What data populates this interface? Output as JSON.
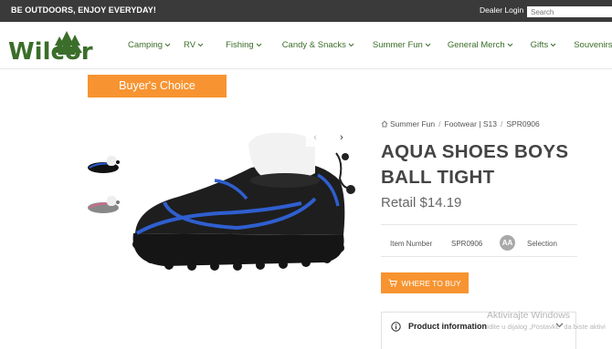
{
  "topbar": {
    "tagline": "BE OUTDOORS, ENJOY EVERYDAY!",
    "dealer_login": "Dealer Login",
    "search_placeholder": "Search"
  },
  "brand": {
    "logo_text": "Wilcor",
    "color": "#3b6e2a"
  },
  "nav": [
    {
      "label": "Camping"
    },
    {
      "label": "RV"
    },
    {
      "label": "Fishing"
    },
    {
      "label": "Candy & Snacks"
    },
    {
      "label": "Summer Fun"
    },
    {
      "label": "General Merch"
    },
    {
      "label": "Gifts"
    },
    {
      "label": "Souvenirs"
    }
  ],
  "badge": {
    "label": "Buyer's Choice"
  },
  "breadcrumb": {
    "items": [
      "Summer Fun",
      "Footwear | S13",
      "SPR0906"
    ]
  },
  "product": {
    "title": "AQUA SHOES BOYS BALL TIGHT",
    "price": "Retail $14.19",
    "item_number_label": "Item Number",
    "item_number": "SPR0906",
    "selection_badge": "AA",
    "selection_label": "Selection"
  },
  "where_to_buy": {
    "label": "WHERE TO BUY"
  },
  "accordion": {
    "product_information": "Product information"
  },
  "watermark": {
    "line1": "Aktivirajte Windows",
    "line2": "Idite u dijalog „Postavke\" da biste aktivi"
  },
  "colors": {
    "accent": "#f79431",
    "nav": "#3b6e2a",
    "topbar": "#3a3a3a"
  }
}
